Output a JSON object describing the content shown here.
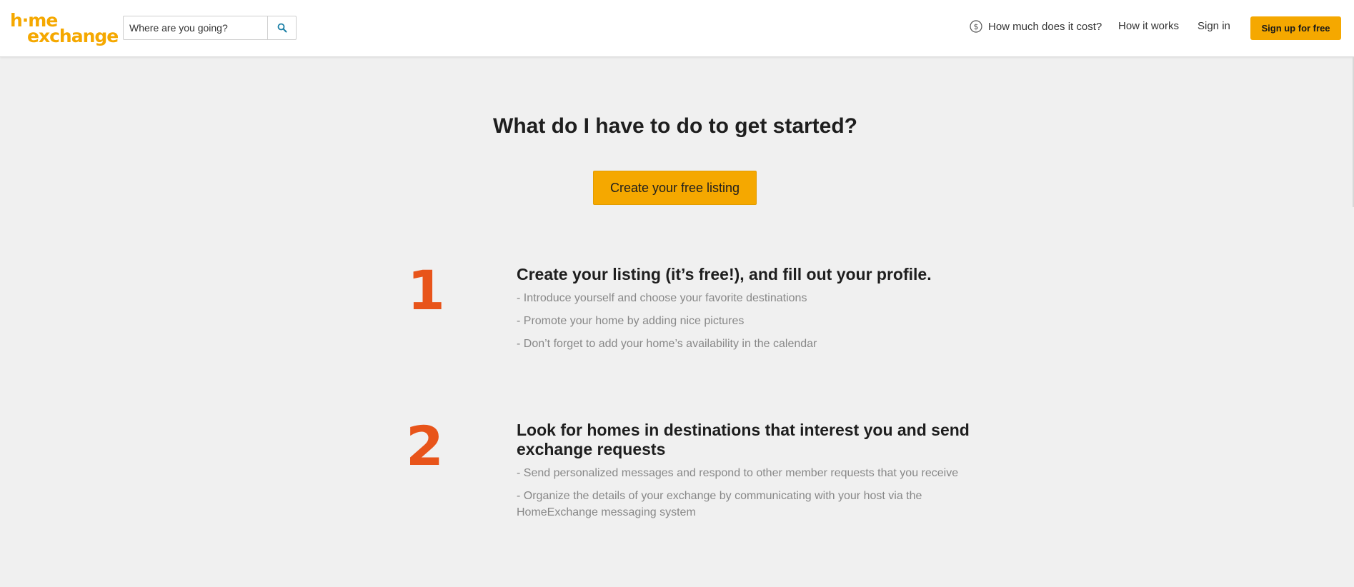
{
  "header": {
    "logo_line1": "h·me",
    "logo_line2": "exchange",
    "search_placeholder": "Where are you going?",
    "nav_cost": "How much does it cost?",
    "nav_how": "How it works",
    "nav_signin": "Sign in",
    "signup_label": "Sign up for free"
  },
  "main": {
    "title": "What do I have to do to get started?",
    "cta_label": "Create your free listing"
  },
  "steps": [
    {
      "number": "1",
      "title": "Create your listing (it’s free!), and fill out your profile.",
      "lines": [
        "- Introduce yourself and choose your favorite destinations",
        "- Promote your home by adding nice pictures",
        "- Don’t forget to add your home’s availability in the calendar"
      ]
    },
    {
      "number": "2",
      "title": "Look for homes in destinations that interest you and send exchange requests",
      "lines": [
        "- Send personalized messages and respond to other member requests that you receive",
        "- Organize the details of your exchange by communicating with your host via the HomeExchange messaging system"
      ]
    }
  ],
  "colors": {
    "brand": "#f5a800",
    "step_number": "#e8541a",
    "background": "#f0f0f0"
  },
  "icons": {
    "search": "search-icon",
    "cost": "dollar-circle-icon"
  }
}
